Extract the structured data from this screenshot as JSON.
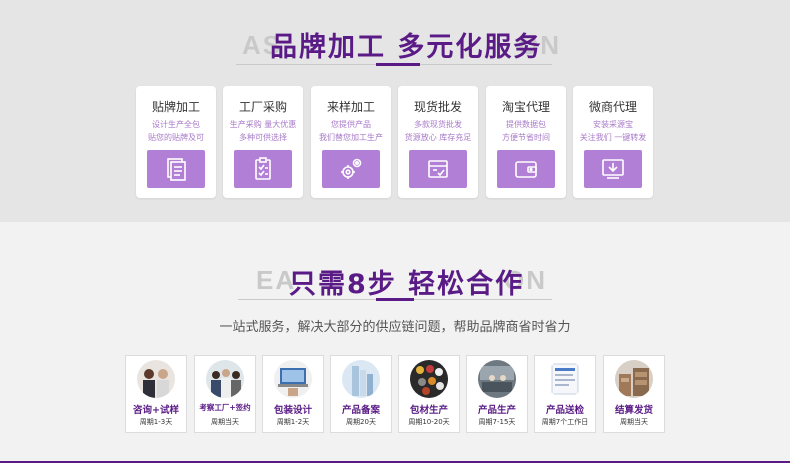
{
  "section1": {
    "bg_letters_left": "AS",
    "bg_letters_right": "ON",
    "title": "品牌加工  多元化服务",
    "services": [
      {
        "title": "贴牌加工",
        "desc1": "设计生产全包",
        "desc2": "贴您的贴牌及可",
        "icon": "document-stack-icon"
      },
      {
        "title": "工厂采购",
        "desc1": "生产采购 量大优惠",
        "desc2": "多种可供选择",
        "icon": "clipboard-check-icon"
      },
      {
        "title": "来样加工",
        "desc1": "您提供产品",
        "desc2": "我们替您加工生产",
        "icon": "gears-icon"
      },
      {
        "title": "现货批发",
        "desc1": "多款现货批发",
        "desc2": "货源放心 库存充足",
        "icon": "box-check-icon"
      },
      {
        "title": "淘宝代理",
        "desc1": "提供数据包",
        "desc2": "方便节省时间",
        "icon": "wallet-icon"
      },
      {
        "title": "微商代理",
        "desc1": "安装采源宝",
        "desc2": "关注我们 一键转发",
        "icon": "download-icon"
      }
    ]
  },
  "section2": {
    "bg_letters_left": "EA",
    "bg_letters_right": "ON",
    "title": "只需8步 轻松合作",
    "subtitle": "一站式服务，解决大部分的供应链问题，帮助品牌商省时省力",
    "steps": [
      {
        "title": "咨询+试样",
        "period": "周期1-3天"
      },
      {
        "title": "考察工厂+签约",
        "period": "周期当天"
      },
      {
        "title": "包装设计",
        "period": "周期1-2天"
      },
      {
        "title": "产品备案",
        "period": "周期20天"
      },
      {
        "title": "包材生产",
        "period": "周期10-20天"
      },
      {
        "title": "产品生产",
        "period": "周期7-15天"
      },
      {
        "title": "产品送检",
        "period": "周期7个工作日"
      },
      {
        "title": "结算发货",
        "period": "周期当天"
      }
    ]
  },
  "colors": {
    "accent": "#5a1b86",
    "icon_box": "#b27fd7",
    "desc": "#a87ac9"
  }
}
